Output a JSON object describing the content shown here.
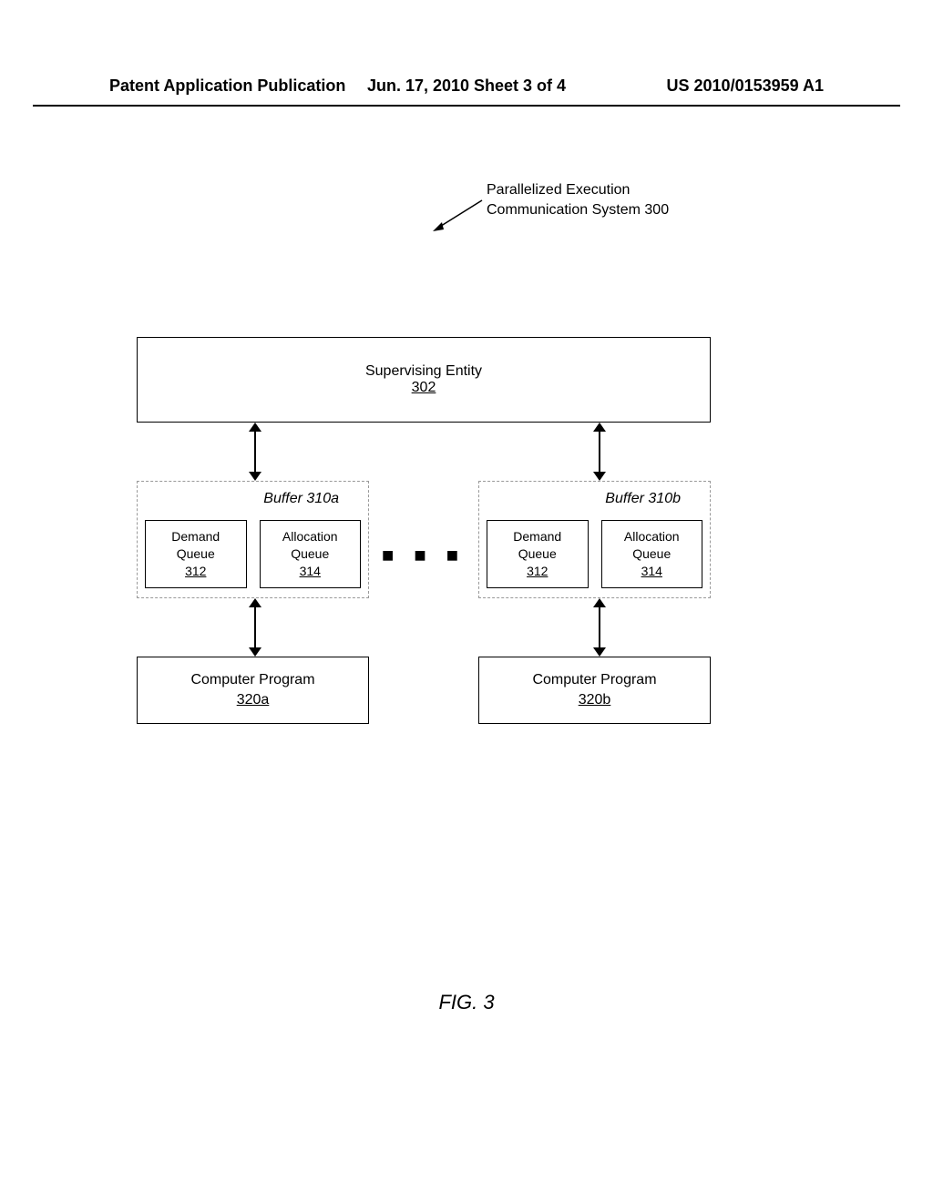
{
  "header": {
    "left": "Patent Application Publication",
    "center": "Jun. 17, 2010  Sheet 3 of 4",
    "right": "US 2010/0153959 A1"
  },
  "callout": {
    "line1": "Parallelized Execution",
    "line2": "Communication System 300"
  },
  "supervising": {
    "title": "Supervising Entity",
    "ref": "302"
  },
  "buffer_a": {
    "title": "Buffer 310a",
    "demand": {
      "l1": "Demand",
      "l2": "Queue",
      "ref": "312"
    },
    "alloc": {
      "l1": "Allocation",
      "l2": "Queue",
      "ref": "314"
    }
  },
  "buffer_b": {
    "title": "Buffer 310b",
    "demand": {
      "l1": "Demand",
      "l2": "Queue",
      "ref": "312"
    },
    "alloc": {
      "l1": "Allocation",
      "l2": "Queue",
      "ref": "314"
    }
  },
  "ellipsis": "■  ■  ■",
  "program_a": {
    "title": "Computer Program",
    "ref": "320a"
  },
  "program_b": {
    "title": "Computer Program",
    "ref": "320b"
  },
  "figure_caption": "FIG. 3"
}
